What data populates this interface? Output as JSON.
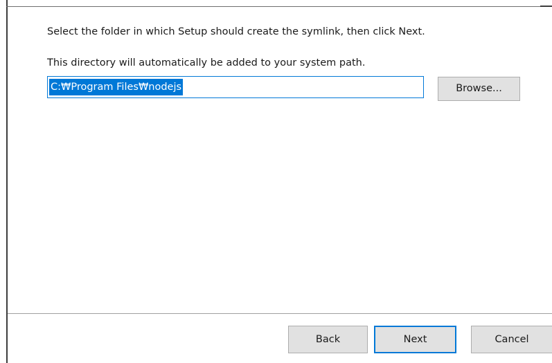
{
  "dialog": {
    "instruction": "Select the folder in which Setup should create the symlink, then click Next.",
    "note": "This directory will automatically be added to your system path.",
    "path_value": "C:\\Program Files\\nodejs",
    "path_display": "C:₩Program Files₩nodejs",
    "browse_label": "Browse..."
  },
  "footer": {
    "back_label": "Back",
    "next_label": "Next",
    "cancel_label": "Cancel"
  },
  "colors": {
    "accent": "#0078d7",
    "button_face": "#e1e1e1",
    "button_border": "#adadad"
  }
}
